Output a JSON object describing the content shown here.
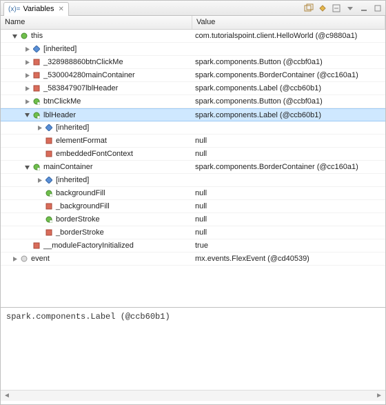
{
  "tab": {
    "title": "Variables"
  },
  "columns": {
    "name": "Name",
    "value": "Value"
  },
  "rows": [
    {
      "depth": 0,
      "toggle": "open",
      "icon": "circle-green",
      "label": "this",
      "value": "com.tutorialspoint.client.HelloWorld (@c9880a1)",
      "selected": false
    },
    {
      "depth": 1,
      "toggle": "closed",
      "icon": "diamond-blue",
      "label": "[inherited]",
      "value": "",
      "selected": false
    },
    {
      "depth": 1,
      "toggle": "closed",
      "icon": "square-red",
      "label": "_328988860btnClickMe",
      "value": "spark.components.Button (@ccbf0a1)",
      "selected": false
    },
    {
      "depth": 1,
      "toggle": "closed",
      "icon": "square-red",
      "label": "_530004280mainContainer",
      "value": "spark.components.BorderContainer (@cc160a1)",
      "selected": false
    },
    {
      "depth": 1,
      "toggle": "closed",
      "icon": "square-red",
      "label": "_583847907lblHeader",
      "value": "spark.components.Label (@ccb60b1)",
      "selected": false
    },
    {
      "depth": 1,
      "toggle": "closed",
      "icon": "circle-green-s",
      "label": "btnClickMe",
      "value": "spark.components.Button (@ccbf0a1)",
      "selected": false
    },
    {
      "depth": 1,
      "toggle": "open",
      "icon": "circle-green-s",
      "label": "lblHeader",
      "value": "spark.components.Label (@ccb60b1)",
      "selected": true
    },
    {
      "depth": 2,
      "toggle": "closed",
      "icon": "diamond-blue",
      "label": "[inherited]",
      "value": "",
      "selected": false
    },
    {
      "depth": 2,
      "toggle": "",
      "icon": "square-red",
      "label": "elementFormat",
      "value": "null",
      "selected": false
    },
    {
      "depth": 2,
      "toggle": "",
      "icon": "square-red",
      "label": "embeddedFontContext",
      "value": "null",
      "selected": false
    },
    {
      "depth": 1,
      "toggle": "open",
      "icon": "circle-green-s",
      "label": "mainContainer",
      "value": "spark.components.BorderContainer (@cc160a1)",
      "selected": false
    },
    {
      "depth": 2,
      "toggle": "closed",
      "icon": "diamond-blue",
      "label": "[inherited]",
      "value": "",
      "selected": false
    },
    {
      "depth": 2,
      "toggle": "",
      "icon": "circle-green-s",
      "label": "backgroundFill",
      "value": "null",
      "selected": false
    },
    {
      "depth": 2,
      "toggle": "",
      "icon": "square-red",
      "label": "_backgroundFill",
      "value": "null",
      "selected": false
    },
    {
      "depth": 2,
      "toggle": "",
      "icon": "circle-green-s",
      "label": "borderStroke",
      "value": "null",
      "selected": false
    },
    {
      "depth": 2,
      "toggle": "",
      "icon": "square-red",
      "label": "_borderStroke",
      "value": "null",
      "selected": false
    },
    {
      "depth": 1,
      "toggle": "",
      "icon": "square-red",
      "label": "__moduleFactoryInitialized",
      "value": "true",
      "selected": false
    },
    {
      "depth": 0,
      "toggle": "closed",
      "icon": "circle-gray",
      "label": "event",
      "value": "mx.events.FlexEvent (@cd40539)",
      "selected": false
    }
  ],
  "detail": "spark.components.Label (@ccb60b1)"
}
